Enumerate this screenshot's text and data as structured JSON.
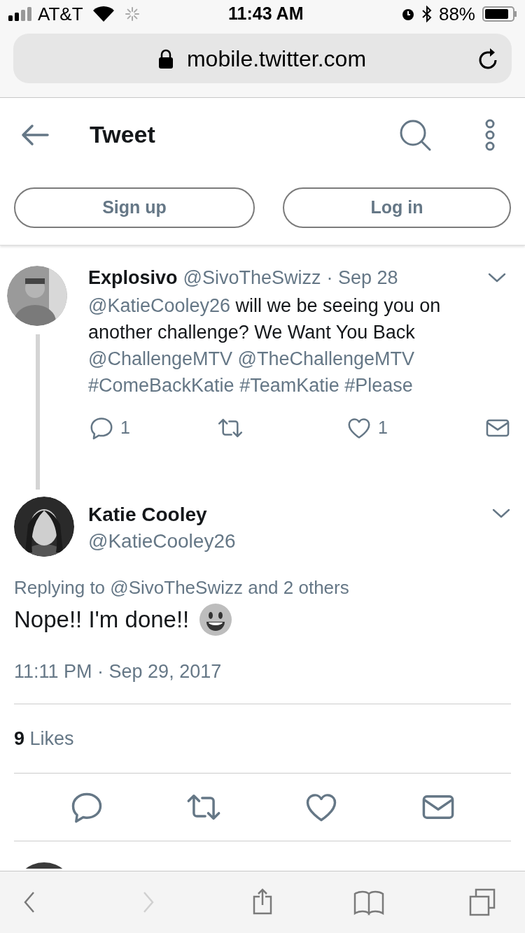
{
  "status_bar": {
    "carrier": "AT&T",
    "time": "11:43 AM",
    "battery": "88%"
  },
  "address_bar": {
    "url": "mobile.twitter.com"
  },
  "header": {
    "title": "Tweet"
  },
  "auth_buttons": [
    {
      "label": "Sign up"
    },
    {
      "label": "Log in"
    }
  ],
  "parent_tweet": {
    "name": "Explosivo",
    "handle": "@SivoTheSwizz",
    "date": "· Sep 28",
    "segments": [
      {
        "kind": "mention",
        "text": "@KatieCooley26"
      },
      {
        "kind": "plain",
        "text": "will we be seeing you on another challenge? We Want You Back"
      },
      {
        "kind": "mention",
        "text": "@ChallengeMTV"
      },
      {
        "kind": "mention",
        "text": "@TheChallengeMTV"
      },
      {
        "kind": "mention",
        "text": "#ComeBackKatie"
      },
      {
        "kind": "mention",
        "text": "#TeamKatie"
      },
      {
        "kind": "mention",
        "text": "#Please"
      }
    ],
    "actions": [
      {
        "kind": "reply",
        "count": "1"
      },
      {
        "kind": "retweet"
      },
      {
        "kind": "like",
        "count": "1"
      },
      {
        "kind": "message"
      }
    ]
  },
  "main_tweet": {
    "name": "Katie Cooley",
    "handle": "@KatieCooley26",
    "replying_to": "Replying to @SivoTheSwizz and 2 others",
    "text": "Nope!! I'm done!!",
    "timestamp": "11:11 PM · Sep 29, 2017",
    "likes_count": "9",
    "likes_label": "Likes",
    "actions": [
      {
        "kind": "reply"
      },
      {
        "kind": "retweet"
      },
      {
        "kind": "like"
      },
      {
        "kind": "message"
      }
    ]
  },
  "toolbar": [
    {
      "kind": "back",
      "disabled": false
    },
    {
      "kind": "forward",
      "disabled": true
    },
    {
      "kind": "share",
      "disabled": false
    },
    {
      "kind": "bookmarks",
      "disabled": false
    },
    {
      "kind": "tabs",
      "disabled": false
    }
  ]
}
